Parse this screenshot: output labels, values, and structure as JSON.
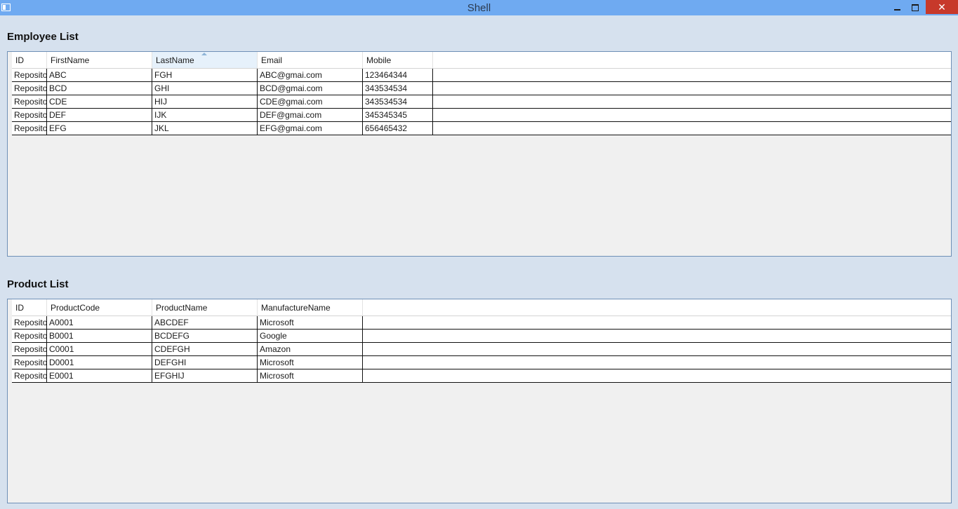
{
  "window": {
    "title": "Shell"
  },
  "employees": {
    "title": "Employee List",
    "columns": [
      "ID",
      "FirstName",
      "LastName",
      "Email",
      "Mobile"
    ],
    "sorted_column": "LastName",
    "rows": [
      [
        "Reposito",
        "ABC",
        "FGH",
        "ABC@gmai.com",
        "123464344"
      ],
      [
        "Reposito",
        "BCD",
        "GHI",
        "BCD@gmai.com",
        "343534534"
      ],
      [
        "Reposito",
        "CDE",
        "HIJ",
        "CDE@gmai.com",
        "343534534"
      ],
      [
        "Reposito",
        "DEF",
        "IJK",
        "DEF@gmai.com",
        "345345345"
      ],
      [
        "Reposito",
        "EFG",
        "JKL",
        "EFG@gmai.com",
        "656465432"
      ]
    ]
  },
  "products": {
    "title": "Product List",
    "columns": [
      "ID",
      "ProductCode",
      "ProductName",
      "ManufactureName"
    ],
    "rows": [
      [
        "Reposito",
        "A0001",
        "ABCDEF",
        "Microsoft"
      ],
      [
        "Reposito",
        "B0001",
        "BCDEFG",
        "Google"
      ],
      [
        "Reposito",
        "C0001",
        "CDEFGH",
        "Amazon"
      ],
      [
        "Reposito",
        "D0001",
        "DEFGHI",
        "Microsoft"
      ],
      [
        "Reposito",
        "E0001",
        "EFGHIJ",
        "Microsoft"
      ]
    ]
  }
}
